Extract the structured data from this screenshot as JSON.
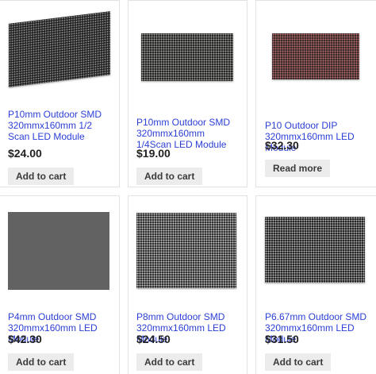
{
  "products": [
    {
      "title": "P10mm Outdoor SMD 320mmx160mm 1/2 Scan LED Module",
      "price": "$24.00",
      "button": "Add to cart"
    },
    {
      "title": "P10mm Outdoor SMD 320mmx160mm 1/4Scan LED Module",
      "price": "$19.00",
      "button": "Add to cart"
    },
    {
      "title": "P10 Outdoor DIP 320mmx160mm LED Module",
      "price": "$32.30",
      "button": "Read more"
    },
    {
      "title": "P4mm Outdoor SMD 320mmx160mm LED Module",
      "price": "$42.30",
      "button": "Add to cart"
    },
    {
      "title": "P8mm Outdoor SMD 320mmx160mm LED Module",
      "price": "$24.50",
      "button": "Add to cart"
    },
    {
      "title": "P6.67mm Outdoor SMD 320mmx160mm LED Module",
      "price": "$31.50",
      "button": "Add to cart"
    }
  ],
  "colors": {
    "link": "#2b3fd6",
    "price": "#222222",
    "button_bg": "#ececec",
    "card_border": "#e2e2e2"
  }
}
